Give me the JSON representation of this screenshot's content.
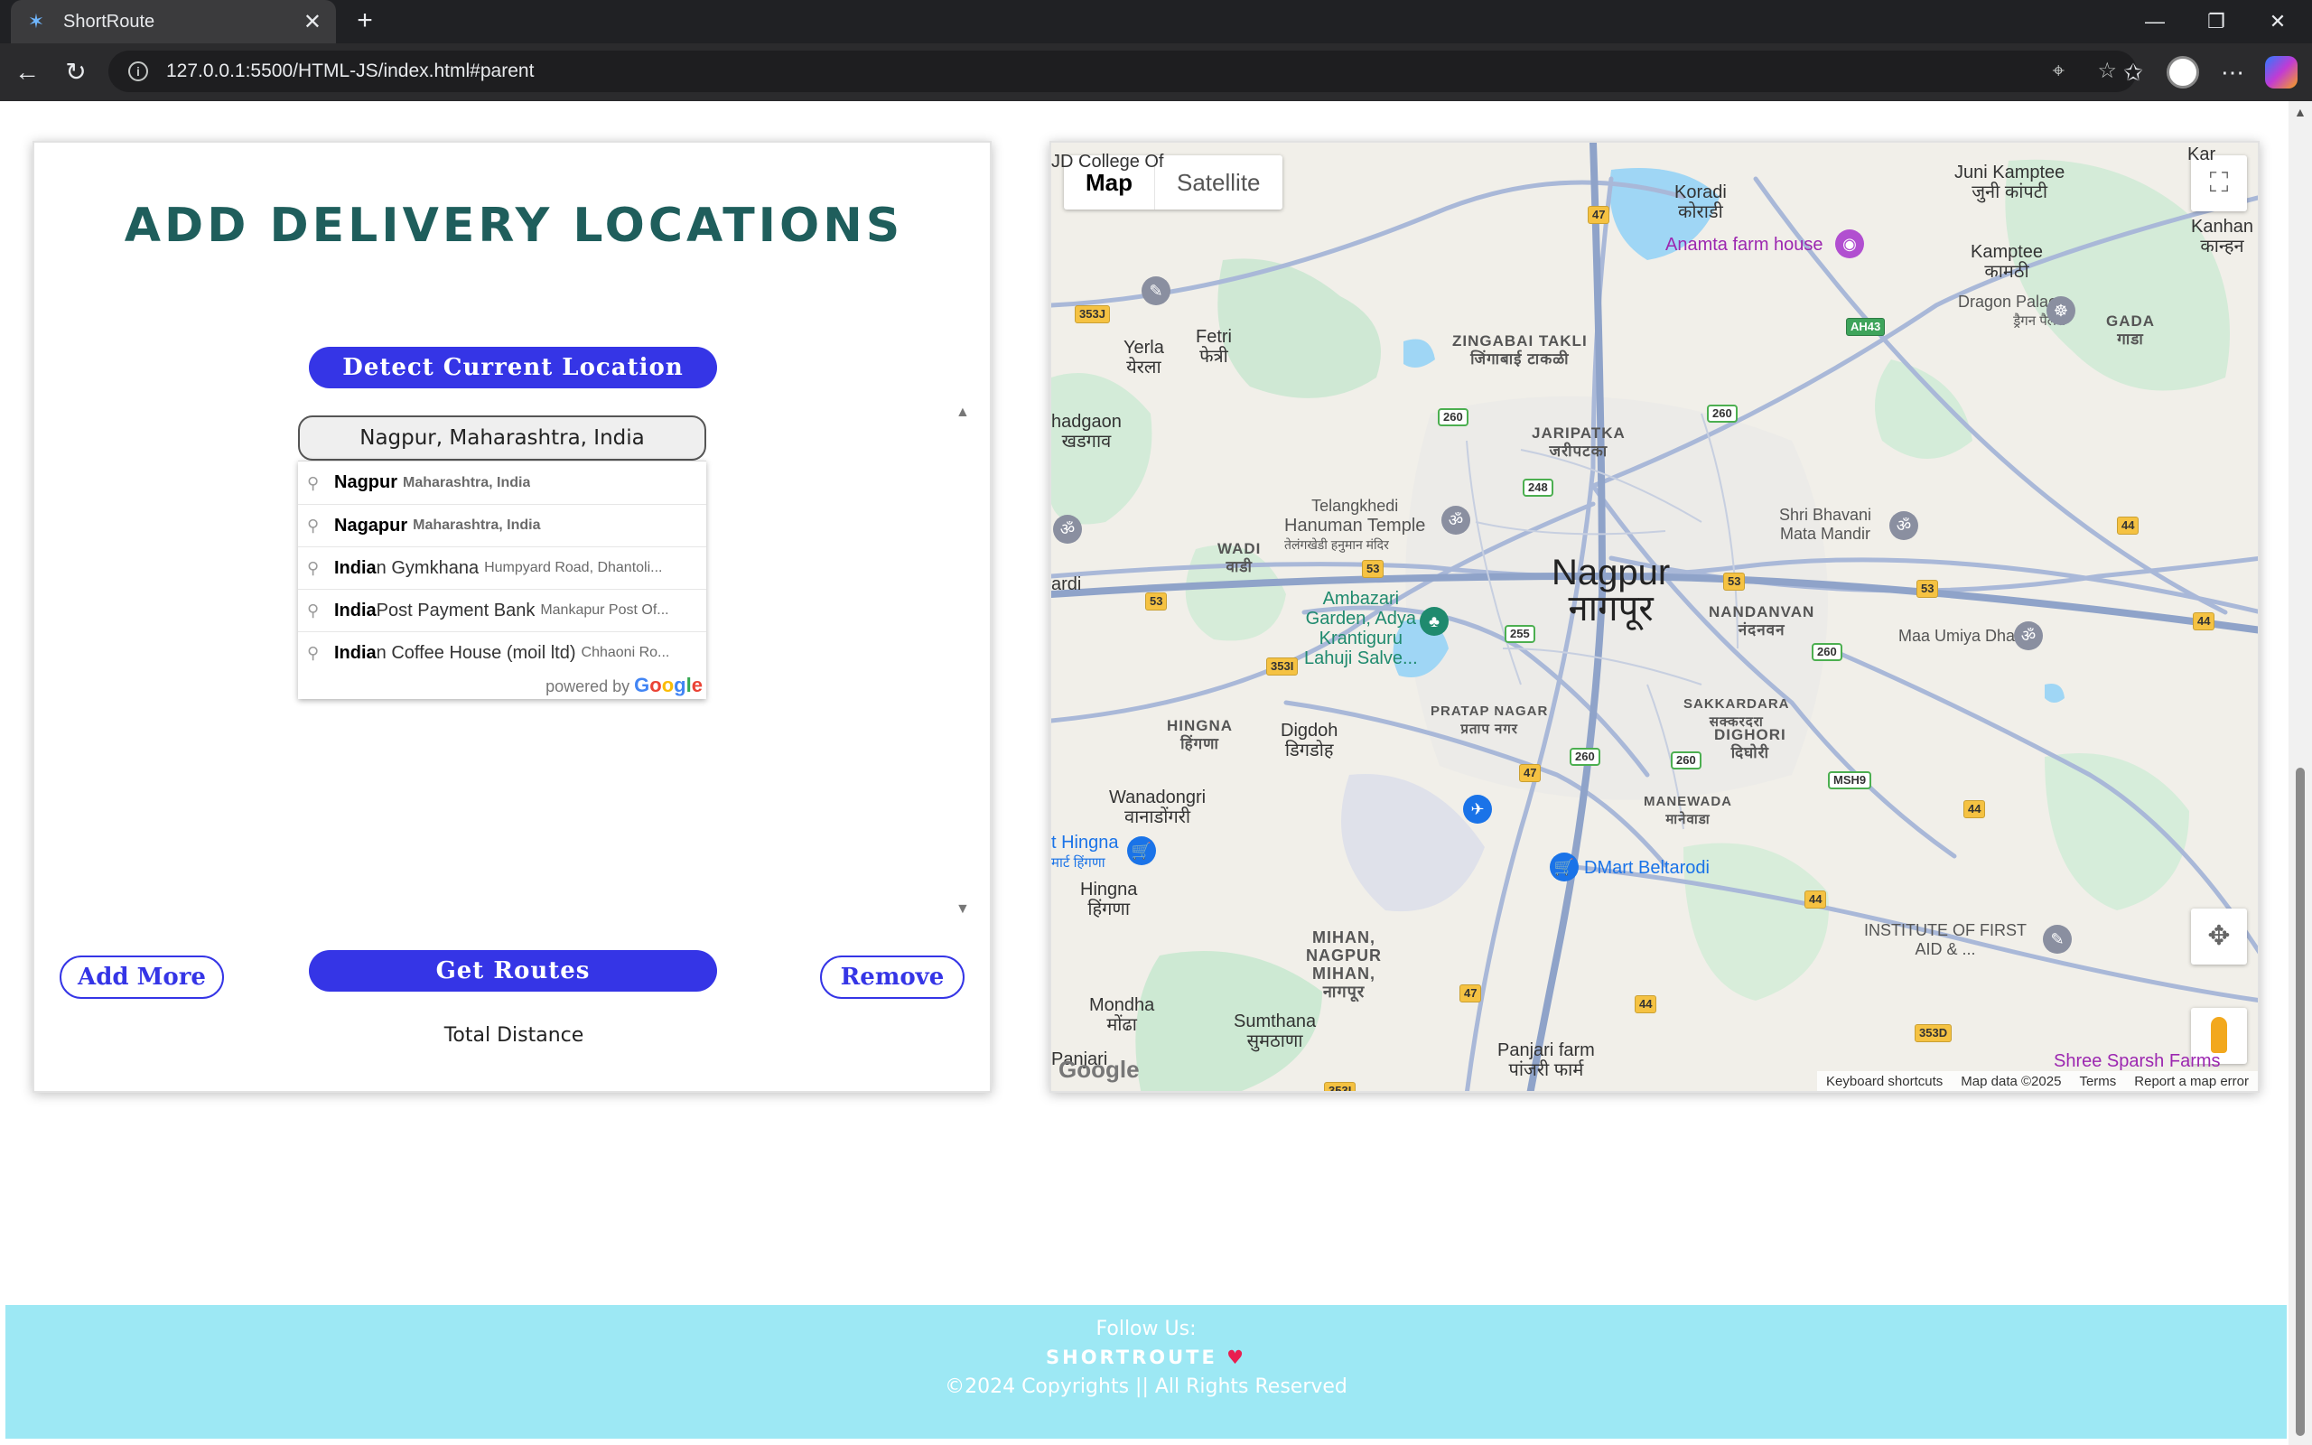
{
  "browser": {
    "tab_title": "ShortRoute",
    "url": "127.0.0.1:5500/HTML-JS/index.html#parent"
  },
  "panel": {
    "title": "ADD DELIVERY LOCATIONS",
    "detect_label": "Detect Current Location",
    "input_value": "Nagpur, Maharashtra, India",
    "routes_label": "Get Routes",
    "add_label": "Add More",
    "remove_label": "Remove",
    "total_label": "Total Distance"
  },
  "autocomplete": {
    "items": [
      {
        "main_bold": "Nagpur",
        "main_rest": "",
        "secondary": "Maharashtra, India",
        "secondary_bold": true
      },
      {
        "main_bold": "Nagapur",
        "main_rest": "",
        "secondary": "Maharashtra, India",
        "secondary_bold": true
      },
      {
        "main_bold": "India",
        "main_rest": "n Gymkhana",
        "secondary": "Humpyard Road, Dhantoli...",
        "secondary_bold": false
      },
      {
        "main_bold": "India",
        "main_rest": " Post Payment Bank",
        "secondary": "Mankapur Post Of...",
        "secondary_bold": false
      },
      {
        "main_bold": "India",
        "main_rest": "n Coffee House (moil ltd)",
        "secondary": "Chhaoni Ro...",
        "secondary_bold": false
      }
    ],
    "powered_by": "powered by",
    "google": "Google"
  },
  "map": {
    "type_map": "Map",
    "type_satellite": "Satellite",
    "city_name": "Nagpur",
    "city_name_local": "नागपूर",
    "labels": {
      "koradi": "Koradi",
      "koradi_local": "कोराडी",
      "juni_kamptee": "Juni Kamptee",
      "juni_kamptee_local": "जुनी कांपटी",
      "kamptee": "Kamptee",
      "kamptee_local": "कामठी",
      "kanhan": "Kanhan",
      "kanhan_local": "कान्हन",
      "anamta": "Anamta farm house",
      "dragon_palace": "Dragon Palace",
      "dragon_palace_local": "ड्रैगन पैलेस",
      "gada": "GADA",
      "gada_local": "गाडा",
      "zingabai": "ZINGABAI TAKLI",
      "zingabai_local": "जिंगाबाई टाकळी",
      "fetri": "Fetri",
      "fetri_local": "फेत्री",
      "yerla": "Yerla",
      "yerla_local": "येरला",
      "jaripatka": "JARIPATKA",
      "jaripatka_local": "जरीपटका",
      "adgaon": "hadgaon",
      "adgaon_local": "खडगाव",
      "telangkhedi": "Telangkhedi",
      "hanuman": "Hanuman Temple",
      "hanuman_local": "तेलंगखेडी हनुमान मंदिर",
      "shri_bhavani": "Shri Bhavani",
      "mata_mandir": "Mata Mandir",
      "wadi": "WADI",
      "wadi_local": "वाडी",
      "nandanvan": "NANDANVAN",
      "nandanvan_local": "नंदनवन",
      "ambazari_1": "Ambazari",
      "ambazari_2": "Garden, Adya",
      "ambazari_3": "Krantiguru",
      "ambazari_4": "Lahuji Salve...",
      "maa_umiya": "Maa Umiya Dham",
      "hingna_area": "HINGNA",
      "hingna_area_local": "हिंगणा",
      "digdoh": "Digdoh",
      "digdoh_local": "डिगडोह",
      "pratap_nagar": "PRATAP NAGAR",
      "pratap_nagar_local": "प्रताप नगर",
      "sakkardara": "SAKKARDARA",
      "sakkardara_local": "सक्करदरा",
      "dighori": "DIGHORI",
      "dighori_local": "दिघोरी",
      "wanadongri": "Wanadongri",
      "wanadongri_local": "वानाडोंगरी",
      "manewada": "MANEWADA",
      "manewada_local": "मानेवाडा",
      "hingna_poi": "t Hingna",
      "hingna_poi_local": "मार्ट हिंगणा",
      "hingna": "Hingna",
      "hingna_local": "हिंगणा",
      "dmart": "DMart Beltarodi",
      "institute_1": "INSTITUTE OF FIRST",
      "institute_2": "AID & ...",
      "mihan_1": "MIHAN,",
      "mihan_2": "NAGPUR",
      "mihan_3": "MIHAN,",
      "mihan_local": "नागपूर",
      "mondha": "Mondha",
      "mondha_local": "मोंढा",
      "sumthana": "Sumthana",
      "sumthana_local": "सुमठाणा",
      "panjari_farm": "Panjari farm",
      "panjari_farm_local": "पांजरी फार्म",
      "panjari": "Panjari",
      "shree_sparsh": "Shree Sparsh Farms",
      "jd_college": "JD College Of",
      "kar": "Kar",
      "ardi": "ardi"
    },
    "shields": [
      "47",
      "353J",
      "AH43",
      "260",
      "260",
      "248",
      "53",
      "53",
      "53",
      "353I",
      "255",
      "260",
      "53",
      "47",
      "260",
      "260",
      "MSH9",
      "44",
      "44",
      "44",
      "47",
      "44",
      "353D",
      "353I",
      "44",
      "53"
    ],
    "footer": {
      "keyboard": "Keyboard shortcuts",
      "map_data": "Map data ©2025",
      "terms": "Terms",
      "report": "Report a map error"
    },
    "google_logo": "Google",
    "colors": {
      "water": "#9fd6f5",
      "park": "#c8ead3",
      "road": "#a9b8d8",
      "highway": "#8fa3c9"
    }
  },
  "footer": {
    "follow": "Follow Us:",
    "brand": "SHORTROUTE",
    "copyright": "©2024 Copyrights || All Rights Reserved"
  },
  "colors": {
    "primary": "#3535e6",
    "title": "#1f5e5c",
    "footer_bg": "#9de8f4",
    "heart": "#e91e4f"
  }
}
